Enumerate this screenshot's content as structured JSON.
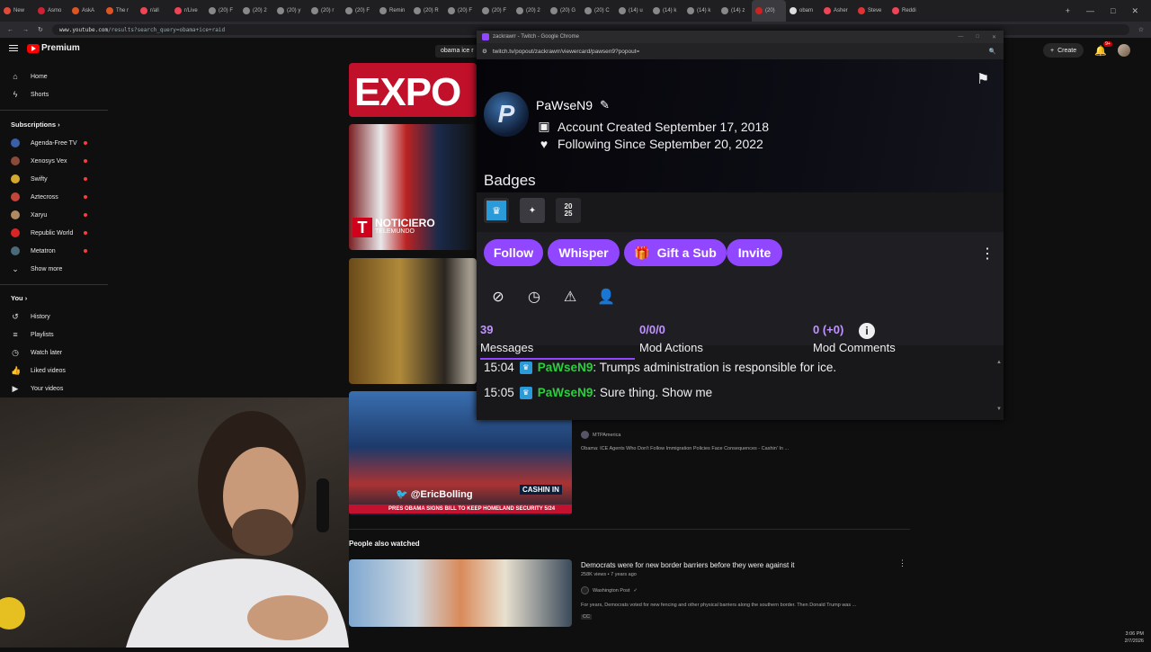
{
  "browser": {
    "tabs": [
      "New",
      "Asmo",
      "AskA",
      "The r",
      "r/all",
      "r/Live",
      "(20) F",
      "(20) 2",
      "(20) y",
      "(20) r",
      "(20) F",
      "Remin",
      "(20) R",
      "(20) F",
      "(20) F",
      "(20) 2",
      "(20) G",
      "(20) C",
      "(14) u",
      "(14) k",
      "(14) k",
      "(14) z",
      "(20)",
      "obam",
      "Asher",
      "Steve",
      "Reddi"
    ],
    "url_host": "www.youtube.com",
    "url_path": "/results?search_query=obama+ice+raid"
  },
  "youtube": {
    "logo": "Premium",
    "search_chip": "obama ice r",
    "nav": [
      "Home",
      "Shorts"
    ],
    "subscriptions_title": "Subscriptions",
    "subscriptions": [
      {
        "name": "Agenda-Free TV",
        "color": "#3a5fa8"
      },
      {
        "name": "Xenosys Vex",
        "color": "#8a4a3a"
      },
      {
        "name": "Swifty",
        "color": "#d4a82c"
      },
      {
        "name": "Aztecross",
        "color": "#c2453a"
      },
      {
        "name": "Xaryu",
        "color": "#b08a60"
      },
      {
        "name": "Republic World",
        "color": "#d92525"
      },
      {
        "name": "Metatron",
        "color": "#4a6a7a"
      }
    ],
    "show_more": "Show more",
    "you_title": "You",
    "you_items": [
      "History",
      "Playlists",
      "Watch later",
      "Liked videos",
      "Your videos"
    ],
    "create_label": "Create",
    "bell_count": "9+",
    "thumb1_text": "EXPO",
    "thumb2_text": "NOTICIERO",
    "thumb2_sub": "TELEMUNDO",
    "thumb4_handle": "@EricBolling",
    "thumb4_banner": "PRES OBAMA SIGNS BILL TO KEEP HOMELAND SECURITY 5/24",
    "thumb4_corner": "CASHIN IN",
    "video4_channel": "MTPAmerica",
    "video4_desc": "Obama: ICE Agents Who Don't Follow Immigration Policies Face Consequences - Cashin' In ...",
    "people_also_watched": "People also watched",
    "video5_title": "Democrats were for new border barriers before they were against it",
    "video5_meta": "258K views • 7 years ago",
    "video5_channel": "Washington Post",
    "video5_desc": "For years, Democrats voted for new fencing and other physical barriers along the southern border. Then Donald Trump was ...",
    "video5_cc": "CC"
  },
  "twitch": {
    "window_title": "zackrawrr - Twitch - Google Chrome",
    "url": "twitch.tv/popout/zackrawrr/viewercard/pawsen9?popout=",
    "username": "PaWseN9",
    "account_created": "Account Created September 17, 2018",
    "following_since": "Following Since September 20, 2022",
    "badges_title": "Badges",
    "badge_year": "20 25",
    "buttons": {
      "follow": "Follow",
      "whisper": "Whisper",
      "gift": "Gift a Sub",
      "invite": "Invite"
    },
    "stats": [
      {
        "num": "39",
        "label": "Messages"
      },
      {
        "num": "0/0/0",
        "label": "Mod Actions"
      },
      {
        "num": "0 (+0)",
        "label": "Mod Comments"
      }
    ],
    "messages": [
      {
        "time": "15:04",
        "user": "PaWseN9",
        "text": ": Trumps administration is responsible for ice."
      },
      {
        "time": "15:05",
        "user": "PaWseN9",
        "text": ": Sure thing. Show me"
      }
    ],
    "colors": {
      "accent": "#9147ff",
      "stat": "#bf94ff",
      "username": "#2ecc40"
    }
  },
  "taskbar": {
    "time": "3:06 PM",
    "date": "2/7/2026"
  }
}
